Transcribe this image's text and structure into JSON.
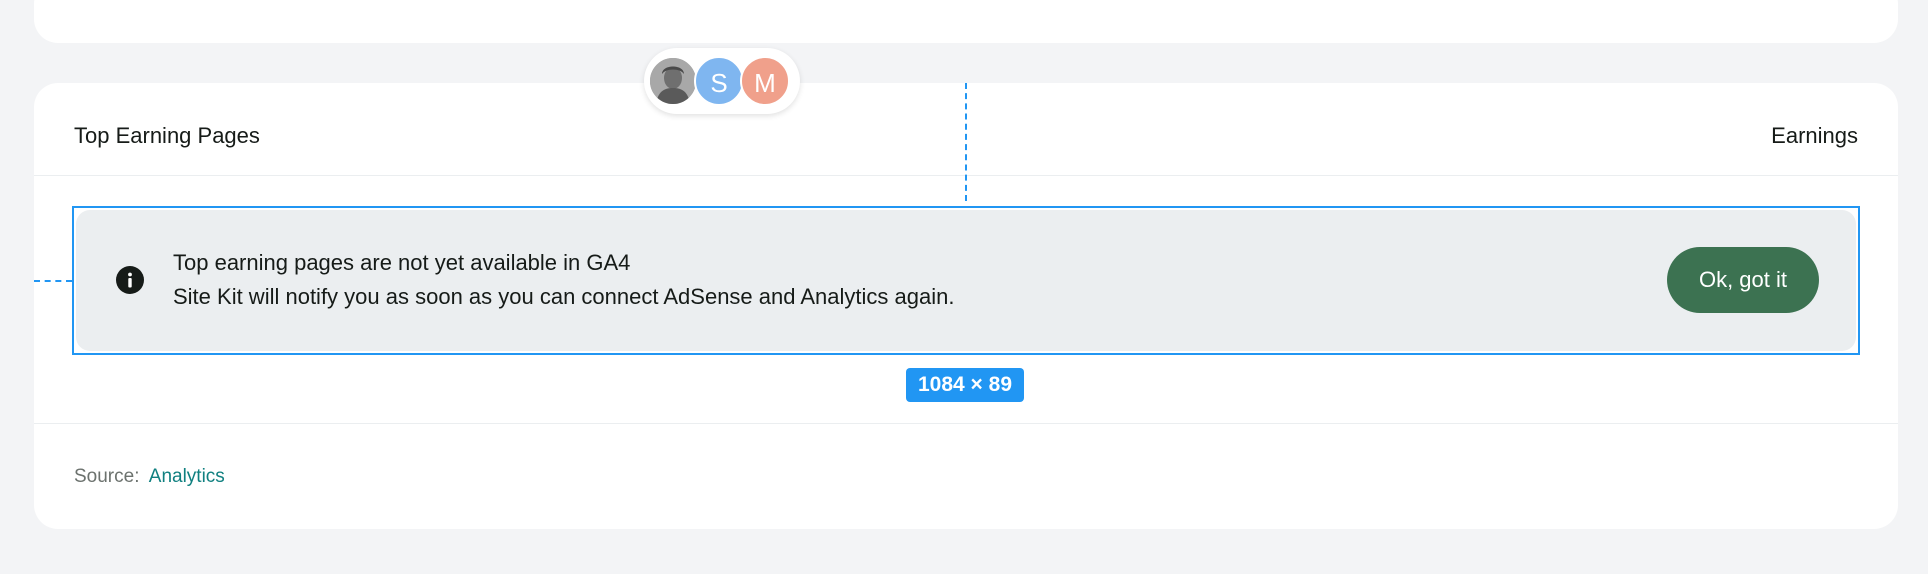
{
  "header": {
    "title": "Top Earning Pages",
    "earnings_label": "Earnings"
  },
  "collaborators": [
    {
      "initial": "",
      "type": "photo"
    },
    {
      "initial": "S",
      "color": "#7fb6f0"
    },
    {
      "initial": "M",
      "color": "#f0a08b"
    }
  ],
  "notice": {
    "title": "Top earning pages are not yet available in GA4",
    "description": "Site Kit will notify you as soon as you can connect AdSense and Analytics again.",
    "button_label": "Ok, got it",
    "icon": "info-icon"
  },
  "selection_overlay": {
    "size_label": "1084 × 89"
  },
  "footer": {
    "source_prefix": "Source:",
    "source_link": "Analytics"
  },
  "colors": {
    "accent": "#2196f3",
    "button": "#3c7251",
    "link": "#108080",
    "notice_bg": "#ebeef0"
  }
}
